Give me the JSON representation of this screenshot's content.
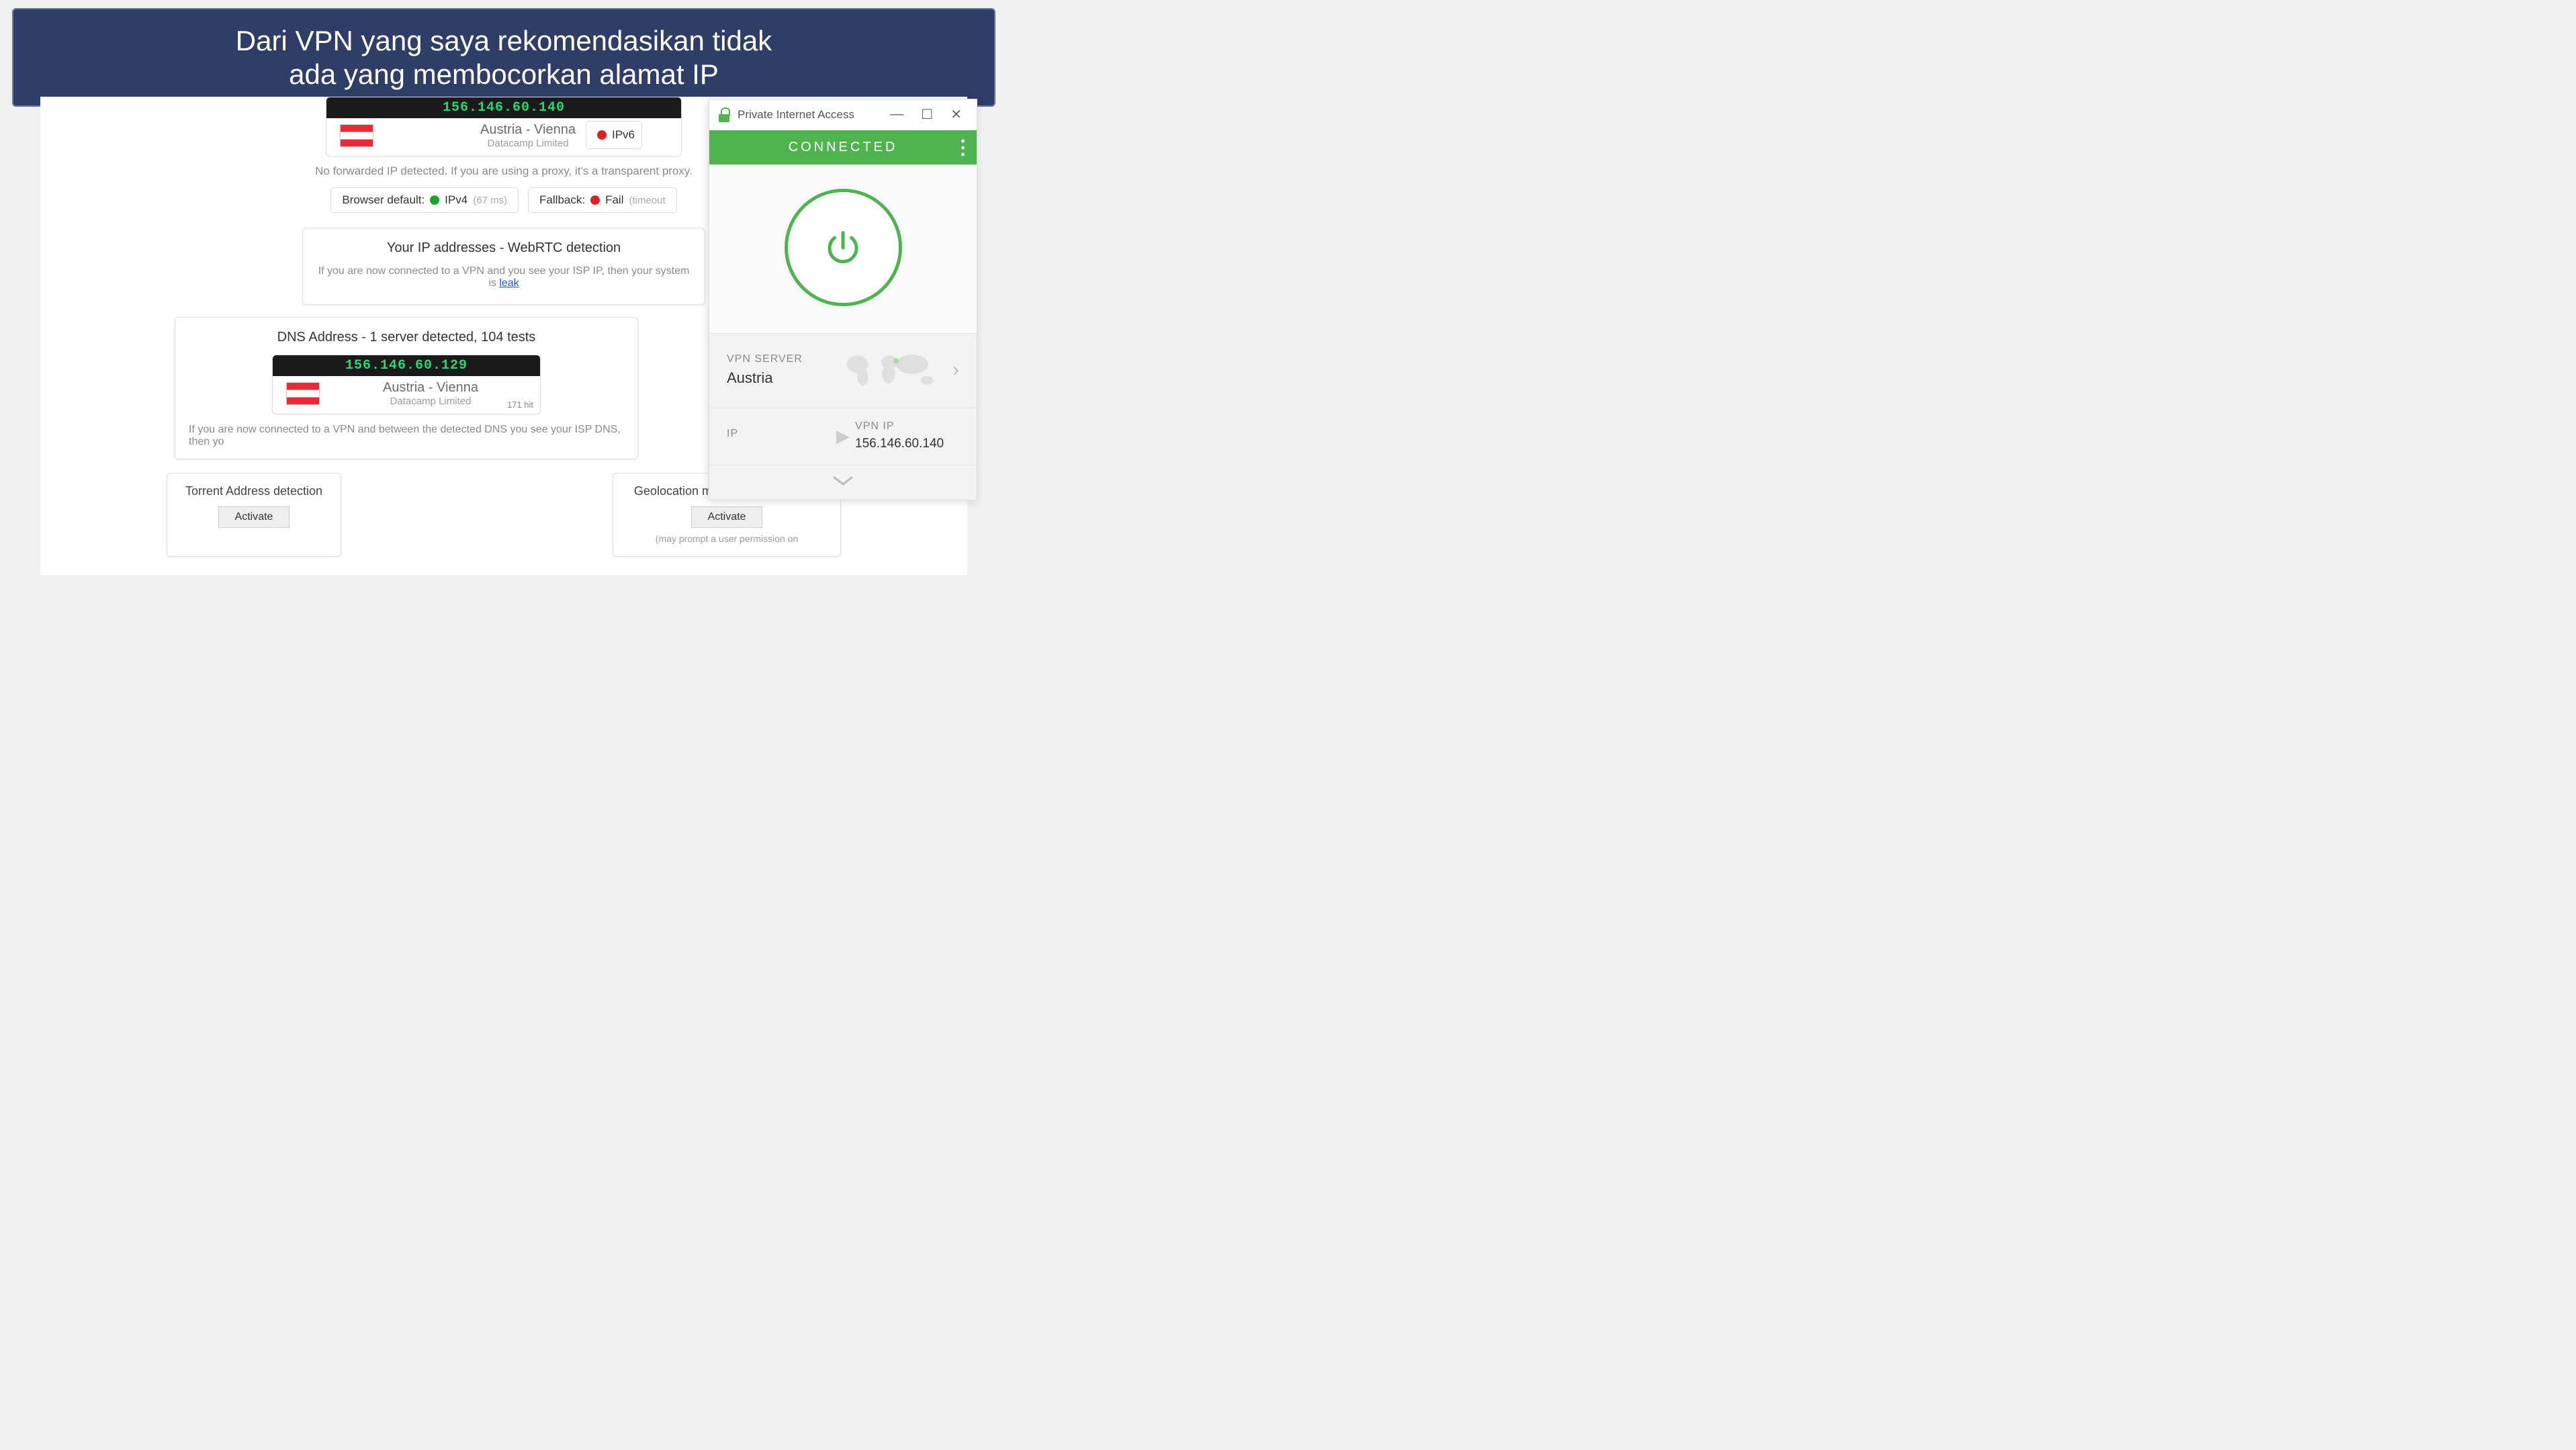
{
  "banner": {
    "line1": "Dari VPN yang saya rekomendasikan tidak",
    "line2": "ada yang membocorkan alamat IP"
  },
  "ip_result_top": {
    "ip": "156.146.60.140",
    "location": "Austria - Vienna",
    "isp": "Datacamp Limited"
  },
  "forward_note": "No forwarded IP detected. If you are using a proxy, it's a transparent proxy.",
  "browser_default": {
    "label": "Browser default:",
    "proto": "IPv4",
    "latency": "(67 ms)"
  },
  "fallback": {
    "label": "Fallback:",
    "status": "Fail",
    "detail": "(timeout"
  },
  "ipv6_side": "IPv6",
  "webrtc": {
    "title": "Your IP addresses - WebRTC detection",
    "note_prefix": "If you are now connected to a VPN and you see your ISP IP, then your system is ",
    "note_link": "leak"
  },
  "dns": {
    "title": "DNS Address - 1 server detected, 104 tests",
    "ip": "156.146.60.129",
    "location": "Austria - Vienna",
    "isp": "Datacamp Limited",
    "hits": "171 hit",
    "note": "If you are now connected to a VPN and between the detected DNS you see your ISP DNS, then yo"
  },
  "torrent": {
    "title": "Torrent Address detection",
    "button": "Activate"
  },
  "geo": {
    "title": "Geolocation map (Google Map) ba",
    "button": "Activate",
    "note": "(may prompt a user permission on"
  },
  "pia": {
    "title": "Private Internet Access",
    "status": "CONNECTED",
    "server_label": "VPN SERVER",
    "server_value": "Austria",
    "ip_label": "IP",
    "vpn_ip_label": "VPN IP",
    "vpn_ip_value": "156.146.60.140"
  }
}
